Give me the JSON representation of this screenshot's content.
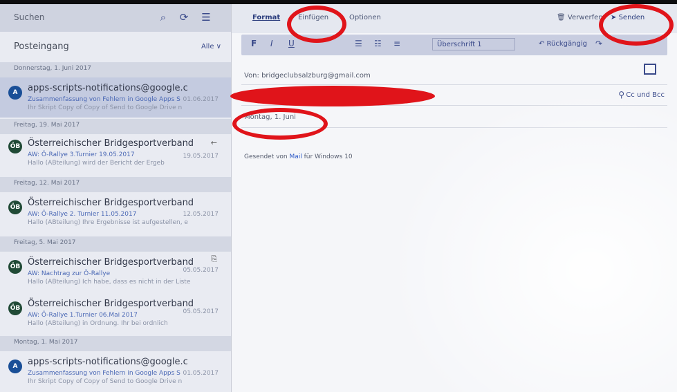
{
  "left_pane": {
    "search_label": "Suchen",
    "icons": [
      "search-icon",
      "sync-icon",
      "filter-list-icon"
    ],
    "folder_name": "Posteingang",
    "filter_label": "Alle ∨",
    "groups": [
      {
        "header": "Donnerstag, 1. Juni 2017"
      },
      {
        "header": "Freitag, 19. Mai 2017"
      },
      {
        "header": "Freitag, 12. Mai 2017"
      },
      {
        "header": "Freitag, 5. Mai 2017"
      },
      {
        "header": "Montag, 1. Mai 2017"
      }
    ],
    "mails": [
      {
        "avatar": "A",
        "sender": "apps-scripts-notifications@google.c",
        "subject": "Zusammenfassung von Fehlern in Google Apps S",
        "preview": "Ihr Skript Copy of Copy of Send to Google Drive n",
        "date": "01.06.2017",
        "selected": true
      },
      {
        "avatar": "ÖB",
        "sender": "Österreichischer Bridgesportverband",
        "subject": "AW: Ö-Rallye 3.Turnier 19.05.2017",
        "preview": "Hallo (ABteilung) wird der Bericht der Ergeb",
        "date": "19.05.2017",
        "flag": "←"
      },
      {
        "avatar": "ÖB",
        "sender": "Österreichischer Bridgesportverband",
        "subject": "AW: Ö-Rallye 2. Turnier 11.05.2017",
        "preview": "Hallo (ABteilung) Ihre Ergebnisse ist aufgestellen, e",
        "date": "12.05.2017"
      },
      {
        "avatar": "ÖB",
        "sender": "Österreichischer Bridgesportverband",
        "subject": "AW: Nachtrag zur Ö-Rallye",
        "preview": "Hallo (ABteilung) Ich habe, dass es nicht in der Liste",
        "date": "05.05.2017",
        "flag": "⎘"
      },
      {
        "avatar": "ÖB",
        "sender": "Österreichischer Bridgesportverband",
        "subject": "AW: Ö-Rallye 1.Turnier 06.Mai 2017",
        "preview": "Hallo (ABteilung) in Ordnung. Ihr bei ordnlich",
        "date": "05.05.2017"
      },
      {
        "avatar": "A",
        "sender": "apps-scripts-notifications@google.c",
        "subject": "Zusammenfassung von Fehlern in Google Apps S",
        "preview": "Ihr Skript Copy of Copy of Send to Google Drive n",
        "date": "01.05.2017"
      }
    ]
  },
  "compose": {
    "tabs": [
      "Format",
      "Einfügen",
      "Optionen"
    ],
    "active_tab": "Format",
    "discard_label": "Verwerfen",
    "send_label": "Senden",
    "toolbar": {
      "bold": "F",
      "italic": "I",
      "underline": "U",
      "bullets": "☰",
      "numbering": "☷",
      "align": "≡",
      "heading": "Überschrift 1",
      "undo_label": "↶ Rückgängig",
      "redo": "↷"
    },
    "from_line": "Von: bridgeclubsalzburg@gmail.com",
    "cc_bcc": "Cc und Bcc",
    "subject_line": "Montag, 1. Juni",
    "signature_prefix": "Gesendet von ",
    "signature_link": "Mail",
    "signature_suffix": " für Windows 10"
  },
  "annotations": {
    "color": "#e0141a",
    "ring_targets": [
      "tab-einfuegen",
      "send-button",
      "subject-line"
    ],
    "redacted": "recipient-field"
  }
}
